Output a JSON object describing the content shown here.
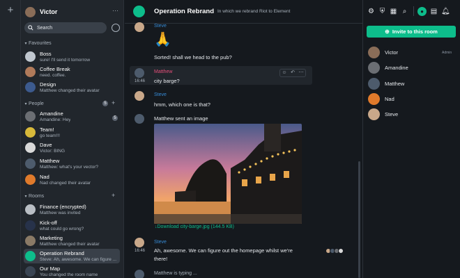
{
  "app": {
    "new_room_icon": "plus-icon"
  },
  "user": {
    "name": "Victor",
    "menu": "···"
  },
  "search": {
    "label": "Search"
  },
  "sections": {
    "favourites": "Favourites",
    "people": "People",
    "people_badge": "5",
    "rooms": "Rooms"
  },
  "favourites": [
    {
      "name": "Boss",
      "preview": "sure! I'll send it tomorrow",
      "color": "#c0c7cf"
    },
    {
      "name": "Coffee Break",
      "preview": "need. coffee.",
      "color": "#b07a5a"
    },
    {
      "name": "Design",
      "preview": "Matthew changed their avatar",
      "color": "#3c5a8e"
    }
  ],
  "people": [
    {
      "name": "Amandine",
      "preview": "Amandine: Hey",
      "color": "#6b6e73",
      "badge": "5"
    },
    {
      "name": "Team!",
      "preview": "go team!!!",
      "color": "#d8b93a"
    },
    {
      "name": "Dave",
      "preview": "Victor: BING",
      "color": "#d9d9d9"
    },
    {
      "name": "Matthew",
      "preview": "Matthew: what's your vector?",
      "color": "#4d5b6c"
    },
    {
      "name": "Nad",
      "preview": "Nad changed their avatar",
      "color": "#e07a2b"
    }
  ],
  "rooms": [
    {
      "name": "Finance (encrypted)",
      "preview": "Matthew was invited",
      "color": "#b9bec4"
    },
    {
      "name": "Kick-off",
      "preview": "what could go wrong?",
      "color": "#27324a"
    },
    {
      "name": "Marketing",
      "preview": "Matthew changed their avatar",
      "color": "#8a7a66"
    },
    {
      "name": "Operation Rebrand",
      "preview": "Steve: Ah, awesome. We can figure ...",
      "color": "#0dbd8b"
    },
    {
      "name": "Our Map",
      "preview": "You changed the room name",
      "color": "#3a4553"
    }
  ],
  "room": {
    "name": "Operation Rebrand",
    "topic": "In which we rebrand Riot to Element"
  },
  "timeline": {
    "msg1": {
      "sender": "Steve",
      "emoji": "🙏",
      "text": "Sorted! shall we head to the pub?"
    },
    "msg2": {
      "sender": "Matthew",
      "time": "16:46",
      "text": "city barge?"
    },
    "msg3": {
      "sender": "Steve",
      "text": "hmm, which one is that?"
    },
    "msg4": {
      "text": "Matthew sent an image",
      "download": "↓Download city-barge.jpg (144.5 KB)"
    },
    "msg5": {
      "sender": "Steve",
      "time": "16:46",
      "line1": "Ah, awesome. We can figure out the homepage whilst we're",
      "line2": "there!"
    },
    "typing": "Matthew is typing ..."
  },
  "colors": {
    "accent": "#0dbd8b",
    "steve": "#368bd6",
    "matthew": "#e64f7a"
  },
  "right_panel": {
    "invite_label": "Invite to this room",
    "admin_label": "Admin",
    "members": [
      "Victor",
      "Amandine",
      "Matthew",
      "Nad",
      "Steve"
    ]
  }
}
